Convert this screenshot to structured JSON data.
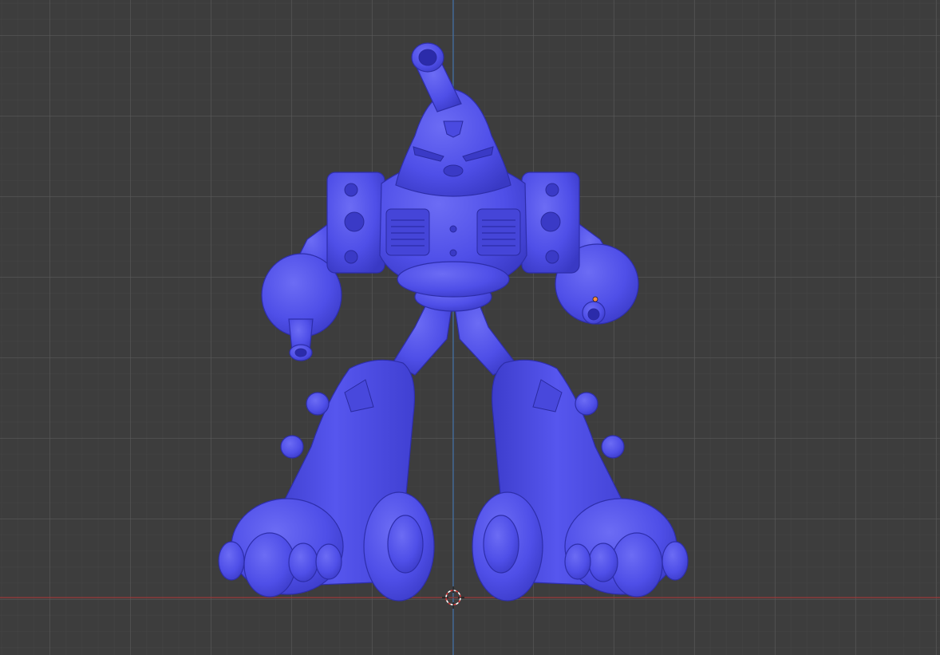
{
  "app": "3D viewport",
  "viewport": {
    "shading": "solid",
    "view": "front-orthographic",
    "background_color": "#3d3d3d",
    "grid_color": "#4a4a4a",
    "x_axis_color": "#9a3a3a",
    "z_axis_color": "#3f6fa6"
  },
  "model": {
    "object": "robot-mesh",
    "material_color": "#4f4fe8",
    "shadow_color": "#3434b8",
    "highlight_color": "#7a7af5"
  },
  "overlays": {
    "cursor": "3d-cursor",
    "origin_color": "#ff8a3c"
  }
}
